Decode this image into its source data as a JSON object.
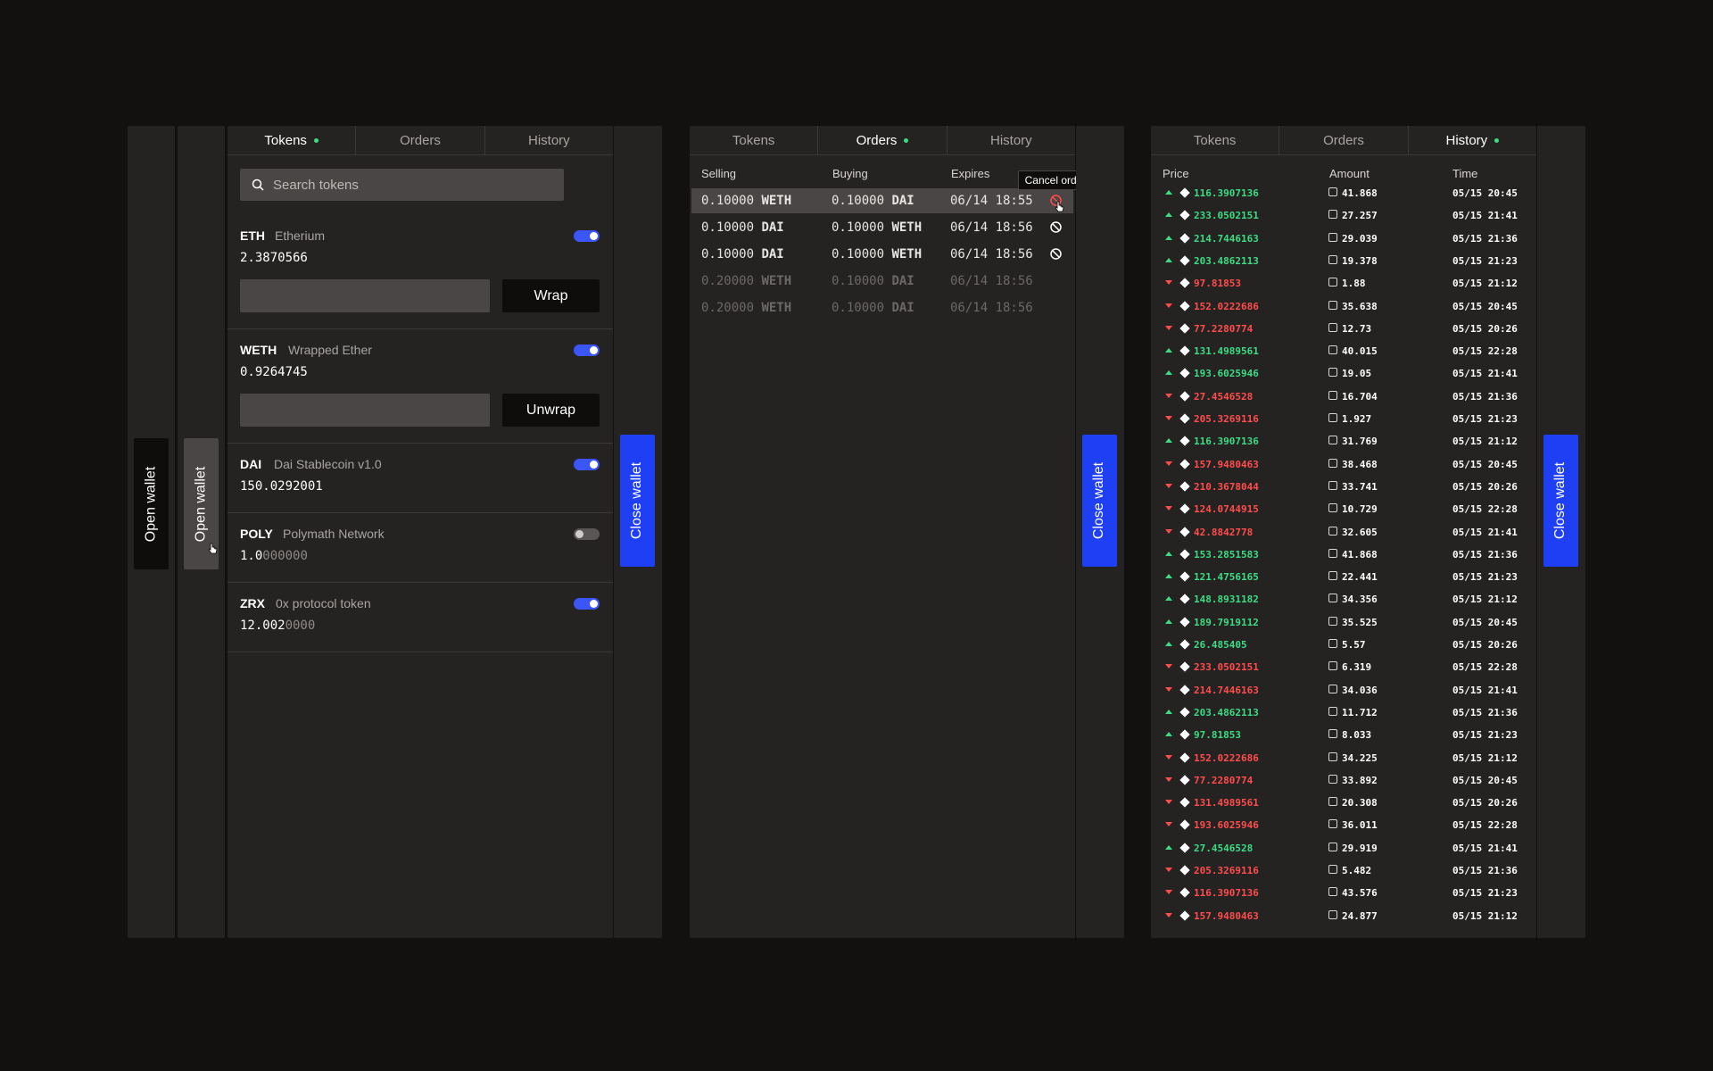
{
  "wallet": {
    "open_label": "Open wallet",
    "close_label": "Close wallet"
  },
  "tabs": [
    "Tokens",
    "Orders",
    "History"
  ],
  "tokens": {
    "search_placeholder": "Search tokens",
    "items": [
      {
        "symbol": "ETH",
        "name": "Etherium",
        "balance": "2.3870566",
        "balance_dim": "",
        "enabled": true,
        "action": "Wrap"
      },
      {
        "symbol": "WETH",
        "name": "Wrapped Ether",
        "balance": "0.9264745",
        "balance_dim": "",
        "enabled": true,
        "action": "Unwrap"
      },
      {
        "symbol": "DAI",
        "name": "Dai Stablecoin v1.0",
        "balance": "150.0292001",
        "balance_dim": "",
        "enabled": true
      },
      {
        "symbol": "POLY",
        "name": "Polymath Network",
        "balance": "1.0",
        "balance_dim": "000000",
        "enabled": false
      },
      {
        "symbol": "ZRX",
        "name": "0x protocol token",
        "balance": "12.002",
        "balance_dim": "0000",
        "enabled": true
      }
    ]
  },
  "orders": {
    "headers": {
      "selling": "Selling",
      "buying": "Buying",
      "expires": "Expires"
    },
    "tooltip": "Cancel order",
    "rows": [
      {
        "sell_amt": "0.10000",
        "sell_tok": "WETH",
        "buy_amt": "0.10000",
        "buy_tok": "DAI",
        "expires": "06/14 18:55"
      },
      {
        "sell_amt": "0.10000",
        "sell_tok": "DAI",
        "buy_amt": "0.10000",
        "buy_tok": "WETH",
        "expires": "06/14 18:56"
      },
      {
        "sell_amt": "0.10000",
        "sell_tok": "DAI",
        "buy_amt": "0.10000",
        "buy_tok": "WETH",
        "expires": "06/14 18:56"
      },
      {
        "sell_amt": "0.20000",
        "sell_tok": "WETH",
        "buy_amt": "0.10000",
        "buy_tok": "DAI",
        "expires": "06/14 18:56"
      },
      {
        "sell_amt": "0.20000",
        "sell_tok": "WETH",
        "buy_amt": "0.10000",
        "buy_tok": "DAI",
        "expires": "06/14 18:56"
      }
    ]
  },
  "history": {
    "headers": {
      "price": "Price",
      "amount": "Amount",
      "time": "Time"
    },
    "rows": [
      {
        "dir": "up",
        "price": "116.3907136",
        "amount": "41.868",
        "time": "05/15 20:45"
      },
      {
        "dir": "up",
        "price": "233.0502151",
        "amount": "27.257",
        "time": "05/15 21:41"
      },
      {
        "dir": "up",
        "price": "214.7446163",
        "amount": "29.039",
        "time": "05/15 21:36"
      },
      {
        "dir": "up",
        "price": "203.4862113",
        "amount": "19.378",
        "time": "05/15 21:23"
      },
      {
        "dir": "down",
        "price": "97.81853",
        "amount": "1.88",
        "time": "05/15 21:12"
      },
      {
        "dir": "down",
        "price": "152.0222686",
        "amount": "35.638",
        "time": "05/15 20:45"
      },
      {
        "dir": "down",
        "price": "77.2280774",
        "amount": "12.73",
        "time": "05/15 20:26"
      },
      {
        "dir": "up",
        "price": "131.4989561",
        "amount": "40.015",
        "time": "05/15 22:28"
      },
      {
        "dir": "up",
        "price": "193.6025946",
        "amount": "19.05",
        "time": "05/15 21:41"
      },
      {
        "dir": "down",
        "price": "27.4546528",
        "amount": "16.704",
        "time": "05/15 21:36"
      },
      {
        "dir": "down",
        "price": "205.3269116",
        "amount": "1.927",
        "time": "05/15 21:23"
      },
      {
        "dir": "up",
        "price": "116.3907136",
        "amount": "31.769",
        "time": "05/15 21:12"
      },
      {
        "dir": "down",
        "price": "157.9480463",
        "amount": "38.468",
        "time": "05/15 20:45"
      },
      {
        "dir": "down",
        "price": "210.3678044",
        "amount": "33.741",
        "time": "05/15 20:26"
      },
      {
        "dir": "down",
        "price": "124.0744915",
        "amount": "10.729",
        "time": "05/15 22:28"
      },
      {
        "dir": "down",
        "price": "42.8842778",
        "amount": "32.605",
        "time": "05/15 21:41"
      },
      {
        "dir": "up",
        "price": "153.2851583",
        "amount": "41.868",
        "time": "05/15 21:36"
      },
      {
        "dir": "up",
        "price": "121.4756165",
        "amount": "22.441",
        "time": "05/15 21:23"
      },
      {
        "dir": "up",
        "price": "148.8931182",
        "amount": "34.356",
        "time": "05/15 21:12"
      },
      {
        "dir": "up",
        "price": "189.7919112",
        "amount": "35.525",
        "time": "05/15 20:45"
      },
      {
        "dir": "up",
        "price": "26.485405",
        "amount": "5.57",
        "time": "05/15 20:26"
      },
      {
        "dir": "down",
        "price": "233.0502151",
        "amount": "6.319",
        "time": "05/15 22:28"
      },
      {
        "dir": "down",
        "price": "214.7446163",
        "amount": "34.036",
        "time": "05/15 21:41"
      },
      {
        "dir": "up",
        "price": "203.4862113",
        "amount": "11.712",
        "time": "05/15 21:36"
      },
      {
        "dir": "up",
        "price": "97.81853",
        "amount": "8.033",
        "time": "05/15 21:23"
      },
      {
        "dir": "down",
        "price": "152.0222686",
        "amount": "34.225",
        "time": "05/15 21:12"
      },
      {
        "dir": "down",
        "price": "77.2280774",
        "amount": "33.892",
        "time": "05/15 20:45"
      },
      {
        "dir": "down",
        "price": "131.4989561",
        "amount": "20.308",
        "time": "05/15 20:26"
      },
      {
        "dir": "down",
        "price": "193.6025946",
        "amount": "36.011",
        "time": "05/15 22:28"
      },
      {
        "dir": "up",
        "price": "27.4546528",
        "amount": "29.919",
        "time": "05/15 21:41"
      },
      {
        "dir": "down",
        "price": "205.3269116",
        "amount": "5.482",
        "time": "05/15 21:36"
      },
      {
        "dir": "down",
        "price": "116.3907136",
        "amount": "43.576",
        "time": "05/15 21:23"
      },
      {
        "dir": "down",
        "price": "157.9480463",
        "amount": "24.877",
        "time": "05/15 21:12"
      }
    ]
  },
  "colors": {
    "accent": "#1f3ff5",
    "up": "#3ddc84",
    "down": "#ff4d4d",
    "cancel_hover": "#ff4d4d"
  }
}
